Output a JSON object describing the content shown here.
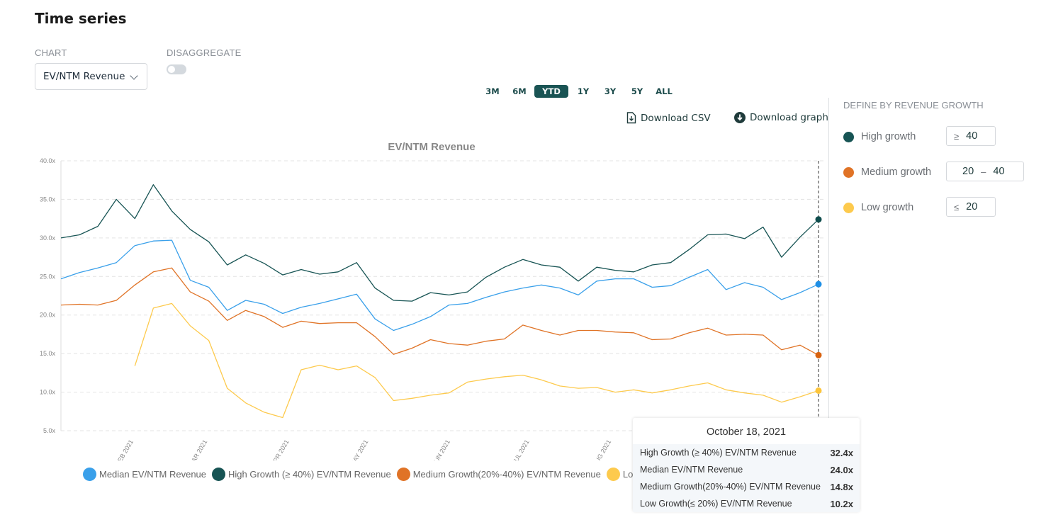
{
  "header": {
    "title": "Time series"
  },
  "controls": {
    "chart_label": "CHART",
    "chart_select_value": "EV/NTM Revenue",
    "disaggregate_label": "DISAGGREGATE",
    "disaggregate_on": false
  },
  "ranges": [
    {
      "label": "3M",
      "active": false
    },
    {
      "label": "6M",
      "active": false
    },
    {
      "label": "YTD",
      "active": true
    },
    {
      "label": "1Y",
      "active": false
    },
    {
      "label": "3Y",
      "active": false
    },
    {
      "label": "5Y",
      "active": false
    },
    {
      "label": "ALL",
      "active": false
    }
  ],
  "downloads": {
    "csv": "Download CSV",
    "graph": "Download graph",
    "csv_icon": "file-download-icon",
    "graph_icon": "circle-download-icon"
  },
  "growth_panel": {
    "title": "DEFINE BY REVENUE GROWTH",
    "groups": [
      {
        "label": "High growth",
        "color": "#175454",
        "operator": "≥",
        "value": "40"
      },
      {
        "label": "Medium growth",
        "color": "#e07326",
        "from": "20",
        "dash": "–",
        "to": "40"
      },
      {
        "label": "Low growth",
        "color": "#fdca4d",
        "operator": "≤",
        "value": "20"
      }
    ]
  },
  "tooltip": {
    "date": "October 18, 2021",
    "rows": [
      {
        "label": "High Growth (≥ 40%) EV/NTM Revenue",
        "value": "32.4x"
      },
      {
        "label": "Median EV/NTM Revenue",
        "value": "24.0x"
      },
      {
        "label": "Medium Growth(20%-40%) EV/NTM Revenue",
        "value": "14.8x"
      },
      {
        "label": "Low Growth(≤ 20%) EV/NTM Revenue",
        "value": "10.2x"
      }
    ]
  },
  "chart_data": {
    "type": "line",
    "title": "EV/NTM Revenue",
    "xlabel": "",
    "ylabel": "",
    "ylim": [
      5,
      40
    ],
    "yticks": [
      "5.0x",
      "10.0x",
      "15.0x",
      "20.0x",
      "25.0x",
      "30.0x",
      "35.0x",
      "40.0x"
    ],
    "ytick_values": [
      5,
      10,
      15,
      20,
      25,
      30,
      35,
      40
    ],
    "xlim": [
      "2021-01-04",
      "2021-10-18"
    ],
    "xticks": [
      {
        "date": "2021-02-01",
        "label": "FEB 2021"
      },
      {
        "date": "2021-03-01",
        "label": "MAR 2021"
      },
      {
        "date": "2021-04-01",
        "label": "APR 2021"
      },
      {
        "date": "2021-05-01",
        "label": "MAY 2021"
      },
      {
        "date": "2021-06-01",
        "label": "JUN 2021"
      },
      {
        "date": "2021-07-01",
        "label": "JUL 2021"
      },
      {
        "date": "2021-08-01",
        "label": "AUG 2021"
      }
    ],
    "grid": true,
    "legend_placement": "bottom",
    "hover_date": "2021-10-18",
    "x": [
      "2021-01-04",
      "2021-01-11",
      "2021-01-18",
      "2021-01-25",
      "2021-02-01",
      "2021-02-08",
      "2021-02-15",
      "2021-02-22",
      "2021-03-01",
      "2021-03-08",
      "2021-03-15",
      "2021-03-22",
      "2021-03-29",
      "2021-04-05",
      "2021-04-12",
      "2021-04-19",
      "2021-04-26",
      "2021-05-03",
      "2021-05-10",
      "2021-05-17",
      "2021-05-24",
      "2021-05-31",
      "2021-06-07",
      "2021-06-14",
      "2021-06-21",
      "2021-06-28",
      "2021-07-05",
      "2021-07-12",
      "2021-07-19",
      "2021-07-26",
      "2021-08-02",
      "2021-08-09",
      "2021-08-16",
      "2021-08-23",
      "2021-08-30",
      "2021-09-06",
      "2021-09-13",
      "2021-09-20",
      "2021-09-27",
      "2021-10-04",
      "2021-10-11",
      "2021-10-18"
    ],
    "series": [
      {
        "name": "Median EV/NTM Revenue",
        "color": "#3aa0ea",
        "marker": "#1e8fe6",
        "values": [
          24.7,
          25.5,
          26.1,
          26.8,
          29.0,
          29.6,
          29.7,
          24.5,
          23.6,
          20.6,
          21.9,
          21.4,
          20.2,
          21.0,
          21.5,
          22.1,
          22.7,
          19.5,
          18.0,
          18.8,
          19.8,
          21.3,
          21.5,
          22.3,
          23.0,
          23.5,
          23.9,
          23.5,
          22.6,
          24.4,
          24.7,
          24.7,
          23.6,
          23.8,
          24.9,
          25.9,
          23.3,
          24.2,
          23.6,
          22.0,
          22.9,
          24.0
        ]
      },
      {
        "name": "High Growth (≥ 40%) EV/NTM Revenue",
        "color": "#175454",
        "marker": "#0f4d4d",
        "values": [
          30.0,
          30.4,
          31.5,
          35.0,
          32.5,
          36.9,
          33.5,
          31.1,
          29.5,
          26.5,
          27.8,
          26.7,
          25.2,
          25.9,
          25.3,
          25.6,
          26.8,
          23.5,
          21.9,
          21.8,
          22.9,
          22.6,
          23.0,
          24.9,
          26.2,
          27.2,
          26.5,
          26.2,
          24.4,
          26.2,
          25.8,
          25.6,
          26.5,
          26.8,
          28.5,
          30.4,
          30.5,
          29.9,
          31.4,
          27.5,
          30.1,
          32.4
        ]
      },
      {
        "name": "Medium Growth(20%-40%) EV/NTM Revenue",
        "color": "#e07326",
        "marker": "#d9620e",
        "values": [
          21.3,
          21.4,
          21.3,
          21.9,
          23.9,
          25.6,
          26.1,
          23.0,
          21.8,
          19.3,
          20.6,
          19.8,
          18.4,
          19.2,
          18.9,
          19.0,
          19.0,
          17.2,
          14.9,
          15.7,
          16.8,
          16.3,
          16.1,
          16.6,
          16.9,
          18.7,
          18.0,
          17.4,
          18.0,
          18.0,
          17.8,
          17.7,
          16.8,
          16.9,
          17.7,
          18.3,
          17.4,
          17.5,
          17.4,
          15.5,
          16.1,
          14.8
        ]
      },
      {
        "name": "Low Growth(≤ 20%) EV/NTM Revenue",
        "color": "#fdca4d",
        "marker": "#fdc53a",
        "values": [
          null,
          null,
          null,
          null,
          13.4,
          20.9,
          21.5,
          18.6,
          16.7,
          10.5,
          8.6,
          7.4,
          6.7,
          12.9,
          13.5,
          12.9,
          13.4,
          11.9,
          8.9,
          9.2,
          9.6,
          9.9,
          11.3,
          11.7,
          12.0,
          12.2,
          11.6,
          10.8,
          10.5,
          10.6,
          10.0,
          10.3,
          9.9,
          10.3,
          10.8,
          11.2,
          10.3,
          9.9,
          9.6,
          8.7,
          9.4,
          10.2
        ]
      }
    ]
  },
  "legend": [
    {
      "label": "Median EV/NTM Revenue",
      "color": "#3aa0ea"
    },
    {
      "label": "High Growth (≥ 40%) EV/NTM Revenue",
      "color": "#175454"
    },
    {
      "label": "Medium Growth(20%-40%) EV/NTM Revenue",
      "color": "#e07326"
    },
    {
      "label": "Low Growth(≤ 20%) EV/NTM Revenue",
      "color": "#fdca4d"
    }
  ]
}
